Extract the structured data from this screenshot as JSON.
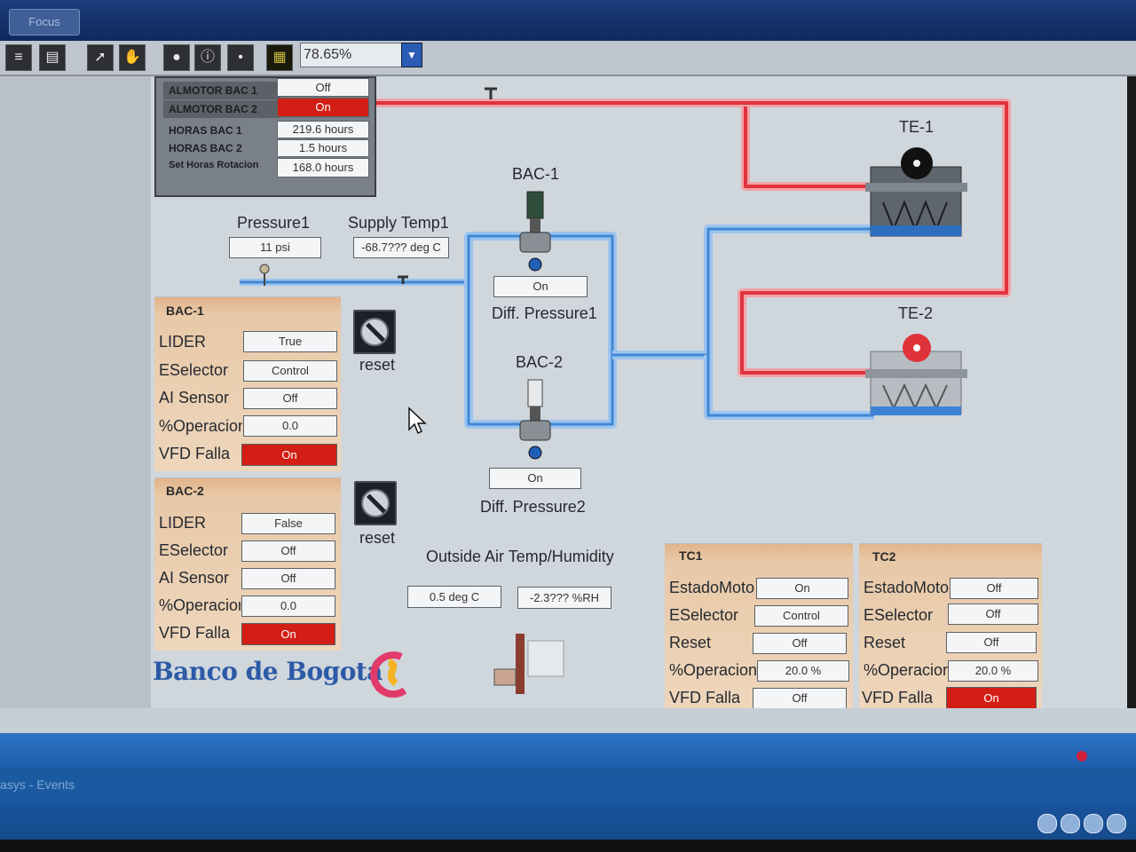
{
  "window": {
    "focus_tab": "Focus"
  },
  "toolbar": {
    "zoom_value": "78.65%"
  },
  "alarm_panel": {
    "rows": [
      {
        "label": "ALMOTOR BAC 1",
        "value": "Off"
      },
      {
        "label": "ALMOTOR BAC 2",
        "value": "On"
      },
      {
        "label": "HORAS BAC 1",
        "value": "219.6 hours"
      },
      {
        "label": "HORAS BAC 2",
        "value": "1.5 hours"
      },
      {
        "label": "Set Horas Rotacion",
        "value": "168.0 hours"
      }
    ]
  },
  "pressure1": {
    "label": "Pressure1",
    "value": "11 psi"
  },
  "supply_temp1": {
    "label": "Supply Temp1",
    "value": "-68.7??? deg C"
  },
  "bac1_equipment": {
    "label": "BAC-1",
    "status": "On",
    "diff_label": "Diff. Pressure1"
  },
  "bac2_equipment": {
    "label": "BAC-2",
    "status": "On",
    "diff_label": "Diff. Pressure2"
  },
  "te1": {
    "label": "TE-1"
  },
  "te2": {
    "label": "TE-2"
  },
  "bac1_panel": {
    "title": "BAC-1",
    "rows": [
      {
        "label": "LIDER",
        "value": "True"
      },
      {
        "label": "ESelector",
        "value": "Control"
      },
      {
        "label": "AI Sensor",
        "value": "Off"
      },
      {
        "label": "%Operacion",
        "value": "0.0"
      },
      {
        "label": "VFD Falla",
        "value": "On"
      }
    ],
    "reset_label": "reset"
  },
  "bac2_panel": {
    "title": "BAC-2",
    "rows": [
      {
        "label": "LIDER",
        "value": "False"
      },
      {
        "label": "ESelector",
        "value": "Off"
      },
      {
        "label": "AI Sensor",
        "value": "Off"
      },
      {
        "label": "%Operacion",
        "value": "0.0"
      },
      {
        "label": "VFD Falla",
        "value": "On"
      }
    ],
    "reset_label": "reset"
  },
  "outside_air": {
    "label": "Outside Air Temp/Humidity",
    "temp": "0.5 deg C",
    "humidity": "-2.3??? %RH"
  },
  "tc1_panel": {
    "title": "TC1",
    "rows": [
      {
        "label": "EstadoMotor",
        "value": "On"
      },
      {
        "label": "ESelector",
        "value": "Control"
      },
      {
        "label": "Reset",
        "value": "Off"
      },
      {
        "label": "%Operacion",
        "value": "20.0 %"
      },
      {
        "label": "VFD Falla",
        "value": "Off"
      }
    ]
  },
  "tc2_panel": {
    "title": "TC2",
    "rows": [
      {
        "label": "EstadoMotor",
        "value": "Off"
      },
      {
        "label": "ESelector",
        "value": "Off"
      },
      {
        "label": "Reset",
        "value": "Off"
      },
      {
        "label": "%Operacion",
        "value": "20.0 %"
      },
      {
        "label": "VFD Falla",
        "value": "On"
      }
    ]
  },
  "logo": {
    "text": "Banco de Bogotá"
  },
  "statusbar": {
    "events_label": "asys - Events"
  },
  "colors": {
    "alarm_red": "#d21e14",
    "pipe_red": "#e8424a",
    "pipe_blue": "#4a90e2",
    "panel_orange": "#e6b88e"
  }
}
